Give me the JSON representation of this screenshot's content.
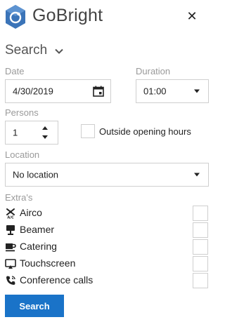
{
  "header": {
    "brand": "GoBright"
  },
  "search_toggle": {
    "label": "Search"
  },
  "date": {
    "label": "Date",
    "value": "4/30/2019"
  },
  "duration": {
    "label": "Duration",
    "value": "01:00"
  },
  "persons": {
    "label": "Persons",
    "value": "1"
  },
  "outside_hours": {
    "label": "Outside opening hours",
    "checked": false
  },
  "location": {
    "label": "Location",
    "value": "No location"
  },
  "extras": {
    "label": "Extra's",
    "items": [
      {
        "label": "Airco",
        "icon": "airco-icon",
        "checked": false
      },
      {
        "label": "Beamer",
        "icon": "projector-icon",
        "checked": false
      },
      {
        "label": "Catering",
        "icon": "coffee-cup-icon",
        "checked": false
      },
      {
        "label": "Touchscreen",
        "icon": "touchscreen-icon",
        "checked": false
      },
      {
        "label": "Conference calls",
        "icon": "phone-icon",
        "checked": false
      }
    ]
  },
  "search_button": {
    "label": "Search"
  },
  "colors": {
    "accent": "#1a73c8",
    "logo": "#3b74b8",
    "muted_label": "#9a9a9a",
    "border": "#cfcfcf"
  }
}
